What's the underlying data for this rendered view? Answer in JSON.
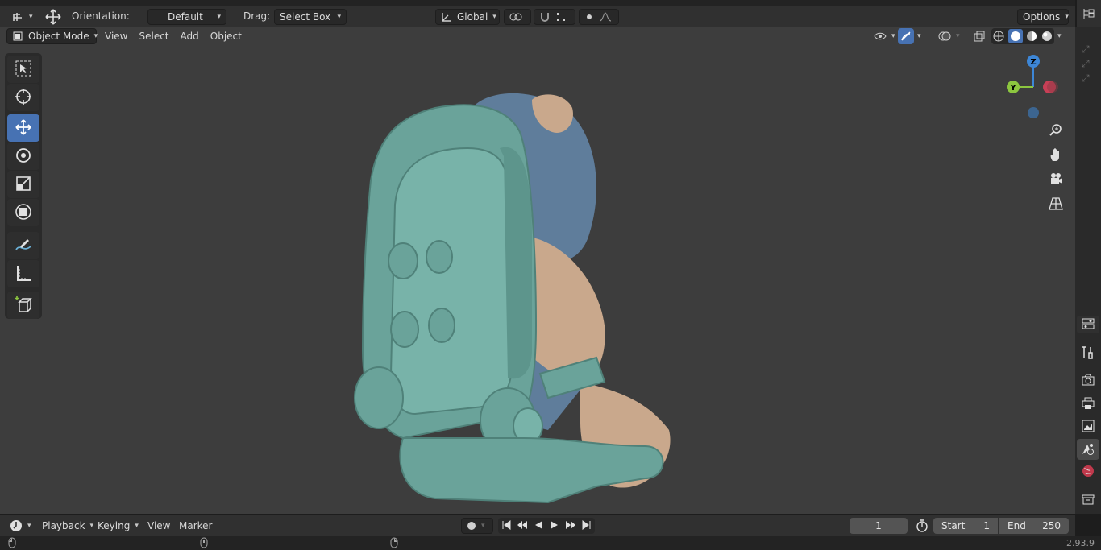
{
  "header": {
    "orientation_label": "Orientation:",
    "orientation_value": "Default",
    "drag_label": "Drag:",
    "drag_value": "Select Box",
    "transform_space": "Global",
    "options_label": "Options"
  },
  "viewport_header": {
    "mode": "Object Mode",
    "menus": [
      "View",
      "Select",
      "Add",
      "Object"
    ]
  },
  "gizmo": {
    "z": "Z",
    "y": "Y"
  },
  "timeline": {
    "menus": [
      "Playback",
      "Keying",
      "View",
      "Marker"
    ],
    "current_frame": "1",
    "start_label": "Start",
    "start_value": "1",
    "end_label": "End",
    "end_value": "250"
  },
  "status": {
    "version": "2.93.9"
  },
  "colors": {
    "accent": "#4772b3",
    "viewport_bg": "#3d3d3d",
    "backpack": "#6aa39a",
    "fur_tan": "#c9a88c",
    "fur_blue": "#5f7d9b",
    "axis_x": "#e0405a",
    "axis_y": "#8cc63f",
    "axis_z": "#3d86d6"
  },
  "icons": {
    "toolbar": [
      "select-box-icon",
      "cursor-icon",
      "move-icon",
      "rotate-icon",
      "scale-icon",
      "transform-icon",
      "annotate-icon",
      "measure-icon",
      "add-cube-icon"
    ],
    "navigation": [
      "zoom-icon",
      "pan-hand-icon",
      "camera-icon",
      "grid-view-icon"
    ],
    "properties": [
      "tool-icon",
      "render-icon",
      "output-icon",
      "view-layer-icon",
      "scene-icon",
      "world-icon",
      "collection-icon"
    ]
  }
}
